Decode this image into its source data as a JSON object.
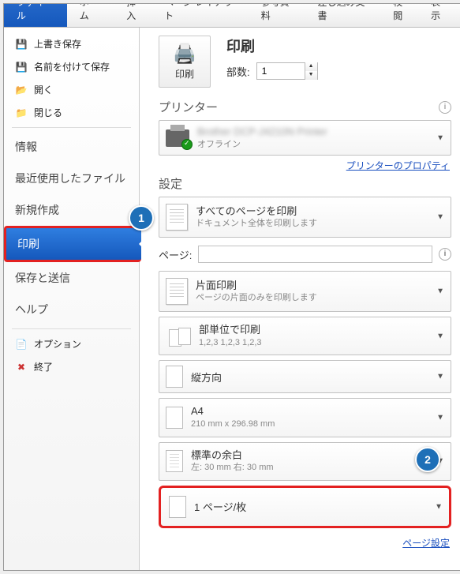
{
  "tabs": {
    "file": "ファイル",
    "home": "ホーム",
    "insert": "挿入",
    "layout": "ページ レイアウト",
    "ref": "参考資料",
    "mail": "差し込み文書",
    "review": "校閲",
    "view": "表示"
  },
  "sidebar": {
    "save": "上書き保存",
    "saveas": "名前を付けて保存",
    "open": "開く",
    "close": "閉じる",
    "info": "情報",
    "recent": "最近使用したファイル",
    "new": "新規作成",
    "print": "印刷",
    "share": "保存と送信",
    "help": "ヘルプ",
    "options": "オプション",
    "exit": "終了"
  },
  "print": {
    "title": "印刷",
    "btn": "印刷",
    "copies_label": "部数:",
    "copies_value": "1"
  },
  "printer": {
    "header": "プリンター",
    "name_blur": "Brother DCP-J4210N Printer",
    "status": "オフライン",
    "props_link": "プリンターのプロパティ"
  },
  "settings": {
    "header": "設定",
    "allpages_title": "すべてのページを印刷",
    "allpages_sub": "ドキュメント全体を印刷します",
    "pages_label": "ページ:",
    "pages_value": "",
    "oneside_title": "片面印刷",
    "oneside_sub": "ページの片面のみを印刷します",
    "collate_title": "部単位で印刷",
    "collate_sub": "1,2,3   1,2,3   1,2,3",
    "orient": "縦方向",
    "paper_title": "A4",
    "paper_sub": "210 mm x 296.98 mm",
    "margin_title": "標準の余白",
    "margin_sub": "左: 30 mm   右: 30 mm",
    "per_sheet": "1 ページ/枚",
    "page_setup_link": "ページ設定"
  },
  "callouts": {
    "c1": "1",
    "c2": "2"
  }
}
